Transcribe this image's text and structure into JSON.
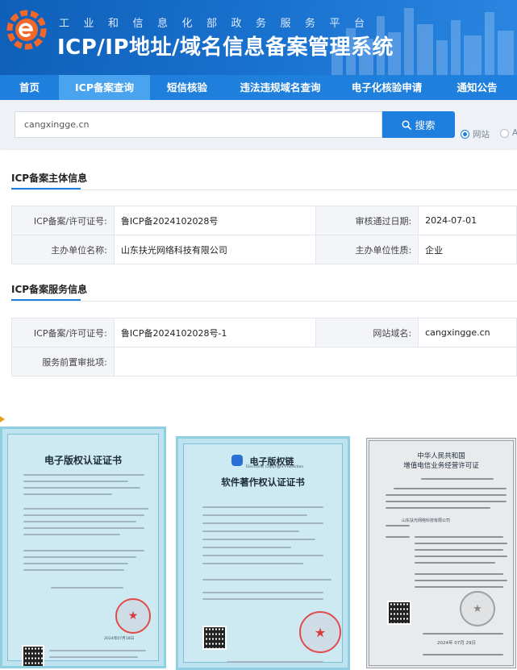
{
  "header": {
    "sub_title": "工业和信息化部政务服务平台",
    "main_title": "ICP/IP地址/域名信息备案管理系统"
  },
  "nav": {
    "items": [
      {
        "label": "首页",
        "active": false
      },
      {
        "label": "ICP备案查询",
        "active": true
      },
      {
        "label": "短信核验",
        "active": false
      },
      {
        "label": "违法违规域名查询",
        "active": false
      },
      {
        "label": "电子化核验申请",
        "active": false
      },
      {
        "label": "通知公告",
        "active": false
      }
    ]
  },
  "search": {
    "value": "cangxingge.cn",
    "button_label": "搜索",
    "options": [
      {
        "label": "网站",
        "selected": true
      },
      {
        "label": "A",
        "selected": false
      }
    ]
  },
  "subject_info": {
    "title": "ICP备案主体信息",
    "rows": [
      [
        {
          "label": "ICP备案/许可证号:",
          "value": "鲁ICP备2024102028号"
        },
        {
          "label": "审核通过日期:",
          "value": "2024-07-01"
        }
      ],
      [
        {
          "label": "主办单位名称:",
          "value": "山东扶光网络科技有限公司"
        },
        {
          "label": "主办单位性质:",
          "value": "企业"
        }
      ]
    ]
  },
  "service_info": {
    "title": "ICP备案服务信息",
    "rows": [
      [
        {
          "label": "ICP备案/许可证号:",
          "value": "鲁ICP备2024102028号-1"
        },
        {
          "label": "网站域名:",
          "value": "cangxingge.cn"
        }
      ],
      [
        {
          "label": "服务前置审批项:",
          "value": ""
        }
      ]
    ]
  },
  "certificates": [
    {
      "title": "电子版权认证证书",
      "date": "2024年07月18日"
    },
    {
      "brand": "电子版权链",
      "brand_en": "Electronic Copyright Protection",
      "title": "软件著作权认证证书"
    },
    {
      "title_line1": "中华人民共和国",
      "title_line2": "增值电信业务经营许可证",
      "company": "山东扶光网络科技有限公司",
      "year": "2024",
      "month": "07",
      "day": "29"
    }
  ],
  "colors": {
    "primary": "#1e7fdc",
    "header": "#0f5fb8",
    "seal": "#e24a4a"
  }
}
